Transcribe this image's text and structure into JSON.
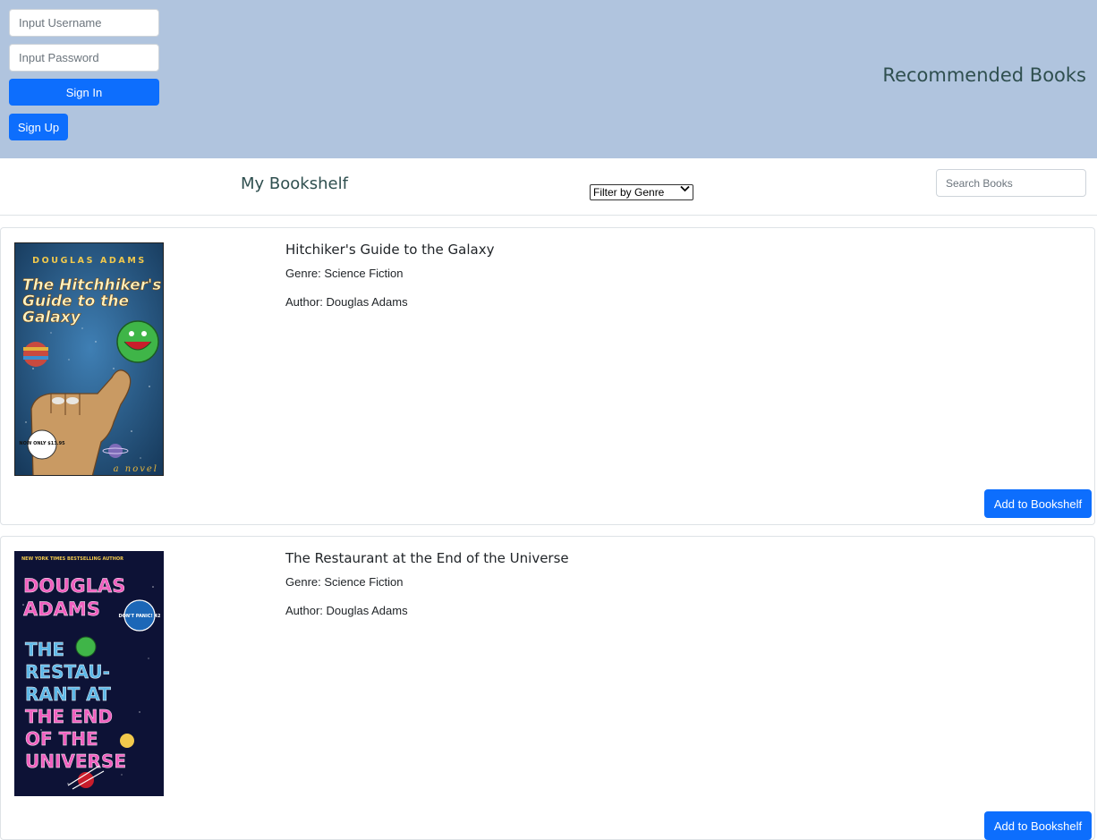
{
  "login": {
    "username_placeholder": "Input Username",
    "password_placeholder": "Input Password",
    "sign_in_label": "Sign In",
    "sign_up_label": "Sign Up"
  },
  "header": {
    "title": "Recommended Books",
    "background_color": "#b0c4de"
  },
  "toolbar": {
    "bookshelf_title": "My Bookshelf",
    "genre_filter_selected": "Filter by Genre",
    "search_placeholder": "Search Books"
  },
  "books": [
    {
      "title": "Hitchiker's Guide to the Galaxy",
      "genre": "Genre: Science Fiction",
      "author": "Author: Douglas Adams",
      "add_label": "Add to Bookshelf",
      "cover": {
        "author_text": "DOUGLAS ADAMS",
        "title_text": "The Hitchhiker's Guide to the Galaxy",
        "footer_text": "a novel",
        "badge_text": "NOW ONLY $13.95",
        "background": "#1f4f7a"
      }
    },
    {
      "title": "The Restaurant at the End of the Universe",
      "genre": "Genre: Science Fiction",
      "author": "Author: Douglas Adams",
      "add_label": "Add to Bookshelf",
      "cover": {
        "top_text": "NEW YORK TIMES BESTSELLING AUTHOR",
        "author_text": "DOUGLAS ADAMS",
        "title_text": "THE RESTAURANT AT THE END OF THE UNIVERSE",
        "badge_text": "DON'T PANIC! 42",
        "background": "#0d1236"
      }
    }
  ],
  "colors": {
    "primary_button": "#0d6efd",
    "heading": "#2f4f4f"
  }
}
